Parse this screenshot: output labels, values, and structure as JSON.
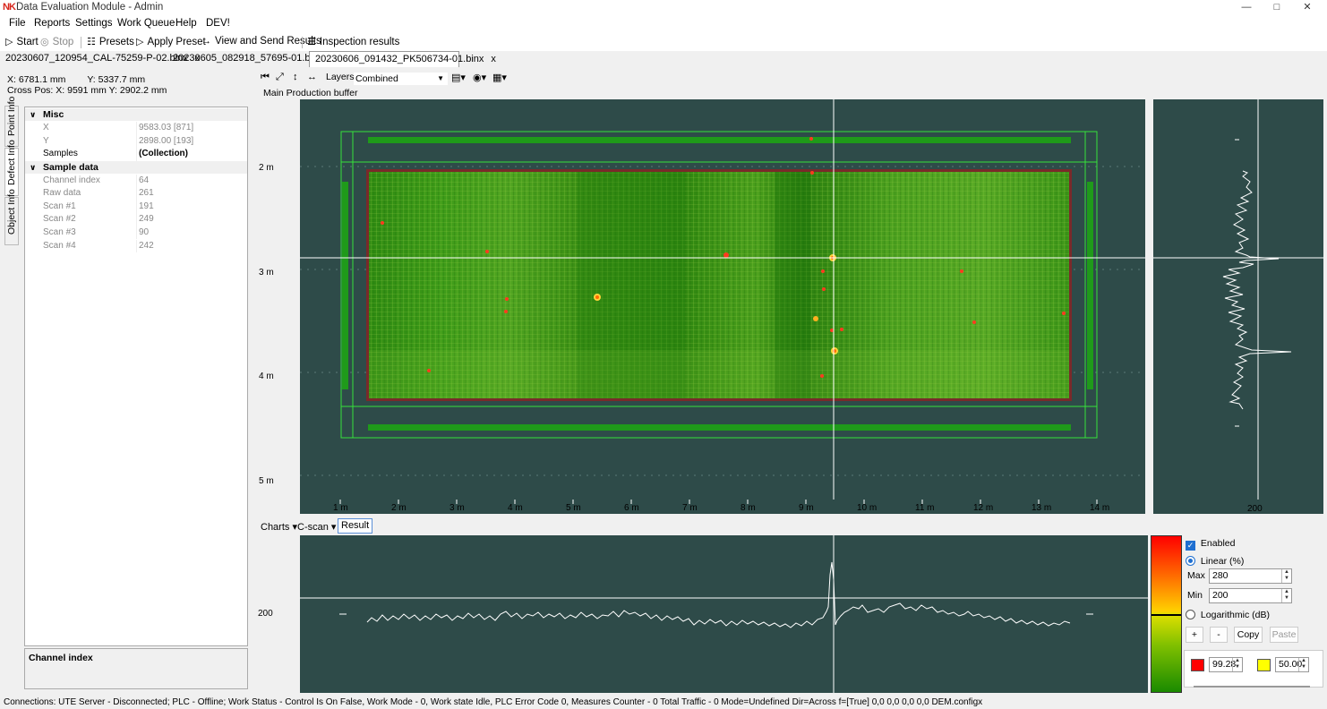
{
  "window": {
    "title": "Data Evaluation Module - Admin",
    "logo": "NK",
    "minimize_icon": "minimize-icon",
    "maximize_icon": "maximize-icon",
    "close_icon": "close-icon"
  },
  "menu": [
    "File",
    "Reports",
    "Settings",
    "Work Queue",
    "Help",
    "DEV!"
  ],
  "toolbar": {
    "start": "Start",
    "stop": "Stop",
    "presets": "Presets",
    "apply_preset": "Apply Preset",
    "view_send": "View and Send Results",
    "inspection": "Inspection results"
  },
  "tabs": [
    {
      "label": "20230607_120954_CAL-75259-P-02.binx",
      "active": false
    },
    {
      "label": "20230605_082918_57695-01.binx",
      "active": false
    },
    {
      "label": "20230606_091432_PK506734-01.binx",
      "active": true
    }
  ],
  "coords": {
    "x": "X: 6781.1 mm",
    "y": "Y: 5337.7 mm",
    "cross": "Cross Pos: X: 9591 mm Y: 2902.2 mm"
  },
  "side_tabs": [
    "Point Info",
    "Defect Info",
    "Object Info"
  ],
  "property_grid": {
    "misc": {
      "title": "Misc",
      "rows": [
        {
          "key": "X",
          "value": "9583.03 [871]"
        },
        {
          "key": "Y",
          "value": "2898.00 [193]"
        },
        {
          "key": "Samples",
          "value": "(Collection)"
        }
      ]
    },
    "sample": {
      "title": "Sample data",
      "rows": [
        {
          "key": "Channel index",
          "value": "64"
        },
        {
          "key": "Raw data",
          "value": "261"
        },
        {
          "key": "Scan #1",
          "value": "191"
        },
        {
          "key": "Scan #2",
          "value": "249"
        },
        {
          "key": "Scan #3",
          "value": "90"
        },
        {
          "key": "Scan #4",
          "value": "242"
        }
      ]
    },
    "description_title": "Channel index"
  },
  "viewer": {
    "layers_label": "Layers",
    "layers_value": "Combined",
    "buffer_label": "Main Production buffer",
    "y_ticks": [
      "2 m",
      "3 m",
      "4 m",
      "5 m"
    ],
    "x_ticks": [
      "1 m",
      "2 m",
      "3 m",
      "4 m",
      "5 m",
      "6 m",
      "7 m",
      "8 m",
      "9 m",
      "10 m",
      "11 m",
      "12 m",
      "13 m",
      "14 m"
    ],
    "right_x_tick": "200",
    "ascan_y_tick": "200"
  },
  "lower_toolbar": {
    "charts": "Charts",
    "cscan": "C-scan",
    "result": "Result"
  },
  "color_controls": {
    "enabled": "Enabled",
    "linear": "Linear (%)",
    "max_label": "Max",
    "max_value": "280",
    "min_label": "Min",
    "min_value": "200",
    "log": "Logarithmic (dB)",
    "plus": "+",
    "minus": "-",
    "copy": "Copy",
    "paste": "Paste",
    "red_value": "99.28",
    "yellow_value": "50.00",
    "red_color": "#ff0000",
    "yellow_color": "#ffff00"
  },
  "status": "Connections:  UTE Server - Disconnected;  PLC - Offline;  Work Status - Control Is On False, Work Mode - 0, Work state Idle, PLC Error Code 0, Measures Counter - 0 Total Traffic - 0 Mode=Undefined Dir=Across f=[True] 0,0 0,0 0,0 0,0  DEM.configx"
}
